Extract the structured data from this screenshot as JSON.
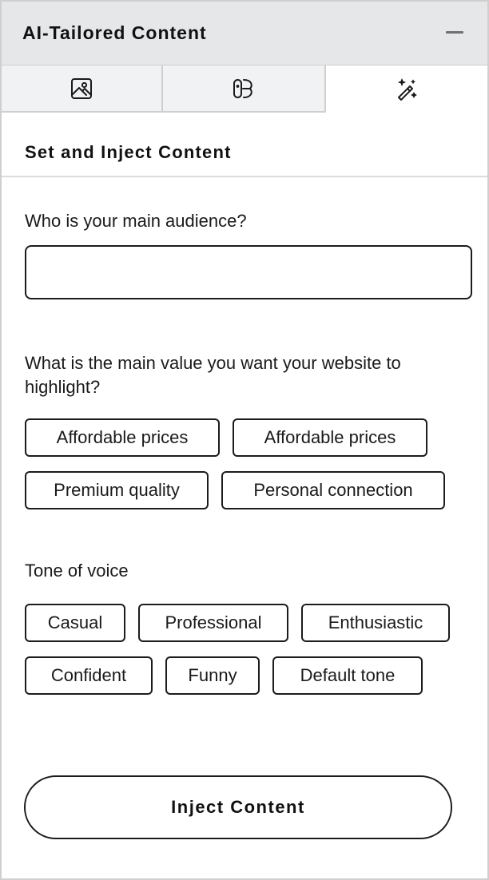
{
  "header": {
    "title": "AI-Tailored Content",
    "collapse_icon": "minus-icon"
  },
  "tabs": [
    {
      "icon": "image-icon",
      "active": false
    },
    {
      "icon": "bandage-icon",
      "active": false
    },
    {
      "icon": "magic-wand-sparkle-icon",
      "active": true
    }
  ],
  "section": {
    "title": "Set and Inject Content"
  },
  "audience": {
    "label": "Who is your main audience?",
    "value": "",
    "placeholder": ""
  },
  "value_question": {
    "label": "What is the main value you want your website to highlight?",
    "options": [
      "Affordable prices",
      "Affordable prices",
      "Premium quality",
      "Personal connection"
    ]
  },
  "tone": {
    "label": "Tone of voice",
    "options": [
      "Casual",
      "Professional",
      "Enthusiastic",
      "Confident",
      "Funny",
      "Default tone"
    ]
  },
  "actions": {
    "inject_label": "Inject Content"
  }
}
